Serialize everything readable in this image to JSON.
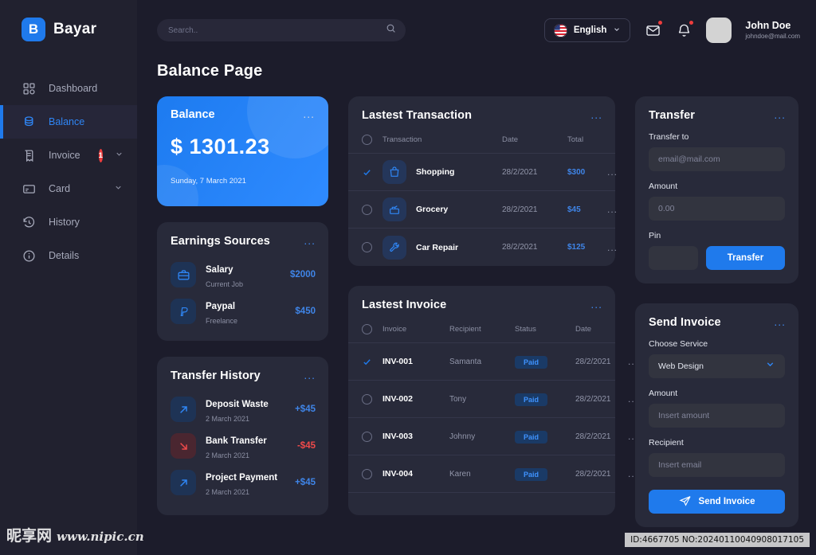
{
  "brand": {
    "initial": "B",
    "name": "Bayar"
  },
  "sidebar": {
    "items": [
      {
        "label": "Dashboard",
        "icon": "grid-icon"
      },
      {
        "label": "Balance",
        "icon": "coins-icon"
      },
      {
        "label": "Invoice",
        "icon": "receipt-icon",
        "badge": "1"
      },
      {
        "label": "Card",
        "icon": "card-icon"
      },
      {
        "label": "History",
        "icon": "history-icon"
      },
      {
        "label": "Details",
        "icon": "info-icon"
      }
    ]
  },
  "topbar": {
    "search_placeholder": "Search..",
    "search_value": "",
    "language": "English",
    "user_name": "John Doe",
    "user_email": "johndoe@mail.com"
  },
  "page": {
    "title": "Balance Page"
  },
  "balance_card": {
    "title": "Balance",
    "amount": "$ 1301.23",
    "date": "Sunday, 7 March 2021",
    "menu": "..."
  },
  "earnings": {
    "title": "Earnings Sources",
    "menu": "...",
    "items": [
      {
        "title": "Salary",
        "sub": "Current Job",
        "amount": "$2000",
        "icon": "briefcase-icon"
      },
      {
        "title": "Paypal",
        "sub": "Freelance",
        "amount": "$450",
        "icon": "paypal-icon"
      }
    ]
  },
  "transfer_history": {
    "title": "Transfer History",
    "menu": "...",
    "items": [
      {
        "title": "Deposit Waste",
        "sub": "2 March 2021",
        "amount": "+$45",
        "direction": "in",
        "icon": "arrow-up-right-icon"
      },
      {
        "title": "Bank Transfer",
        "sub": "2 March 2021",
        "amount": "-$45",
        "direction": "out",
        "icon": "arrow-down-right-icon"
      },
      {
        "title": "Project Payment",
        "sub": "2 March 2021",
        "amount": "+$45",
        "direction": "in",
        "icon": "arrow-up-right-icon"
      }
    ]
  },
  "transactions": {
    "title": "Lastest Transaction",
    "menu": "...",
    "columns": [
      "Transaction",
      "Date",
      "Total"
    ],
    "rows": [
      {
        "name": "Shopping",
        "date": "28/2/2021",
        "total": "$300",
        "checked": true,
        "icon": "shopping-bag-icon",
        "menu": "..."
      },
      {
        "name": "Grocery",
        "date": "28/2/2021",
        "total": "$45",
        "checked": false,
        "icon": "grocery-icon",
        "menu": "..."
      },
      {
        "name": "Car Repair",
        "date": "28/2/2021",
        "total": "$125",
        "checked": false,
        "icon": "wrench-icon",
        "menu": "..."
      }
    ]
  },
  "invoices": {
    "title": "Lastest Invoice",
    "menu": "...",
    "columns": [
      "Invoice",
      "Recipient",
      "Status",
      "Date"
    ],
    "rows": [
      {
        "invoice": "INV-001",
        "recipient": "Samanta",
        "status": "Paid",
        "date": "28/2/2021",
        "checked": true,
        "menu": "..."
      },
      {
        "invoice": "INV-002",
        "recipient": "Tony",
        "status": "Paid",
        "date": "28/2/2021",
        "checked": false,
        "menu": "..."
      },
      {
        "invoice": "INV-003",
        "recipient": "Johnny",
        "status": "Paid",
        "date": "28/2/2021",
        "checked": false,
        "menu": "..."
      },
      {
        "invoice": "INV-004",
        "recipient": "Karen",
        "status": "Paid",
        "date": "28/2/2021",
        "checked": false,
        "menu": "..."
      }
    ]
  },
  "transfer": {
    "title": "Transfer",
    "menu": "...",
    "to_label": "Transfer to",
    "to_placeholder": "email@mail.com",
    "to_value": "",
    "amount_label": "Amount",
    "amount_placeholder": "0.00",
    "amount_value": "",
    "pin_label": "Pin",
    "pin_value": "",
    "button": "Transfer"
  },
  "send_invoice": {
    "title": "Send Invoice",
    "menu": "...",
    "service_label": "Choose Service",
    "service_value": "Web Design",
    "amount_label": "Amount",
    "amount_placeholder": "Insert amount",
    "amount_value": "",
    "recipient_label": "Recipient",
    "recipient_placeholder": "Insert email",
    "recipient_value": "",
    "button": "Send Invoice"
  },
  "watermark": {
    "cn": "昵享网",
    "url": "www.nipic.cn",
    "id": "ID:4667705 NO:20240110040908017105"
  },
  "colors": {
    "accent": "#1f7aec",
    "page_bg": "#1c1c2b",
    "card_bg": "#282a3a",
    "danger": "#ee3d3d"
  }
}
